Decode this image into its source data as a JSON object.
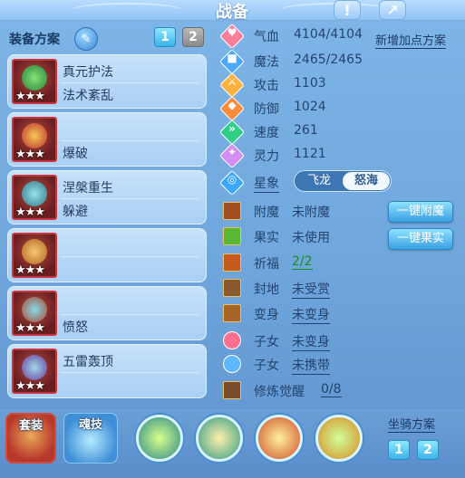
{
  "title": "战备",
  "equipment_section": {
    "label": "装备方案",
    "plan_buttons": [
      "1",
      "2"
    ],
    "active_plan": "1",
    "items": [
      {
        "line1": "真元护法",
        "line2": "法术紊乱",
        "stars": "★★★"
      },
      {
        "line1": "",
        "line2": "爆破",
        "stars": "★★★"
      },
      {
        "line1": "涅槃重生",
        "line2": "躲避",
        "stars": "★★★"
      },
      {
        "line1": "",
        "line2": "",
        "stars": "★★★"
      },
      {
        "line1": "",
        "line2": "愤怒",
        "stars": "★★★"
      },
      {
        "line1": "五雷轰顶",
        "line2": "",
        "stars": "★★★"
      }
    ]
  },
  "attributes": [
    {
      "icon": "heart-icon",
      "label": "气血",
      "value": "4104/4104",
      "color": "#ff7f9a",
      "glyph": "♥"
    },
    {
      "icon": "mana-icon",
      "label": "魔法",
      "value": "2465/2465",
      "color": "#4aa9ff",
      "glyph": "■"
    },
    {
      "icon": "attack-icon",
      "label": "攻击",
      "value": "1103",
      "color": "#ffb13b",
      "glyph": "⚔"
    },
    {
      "icon": "defense-icon",
      "label": "防御",
      "value": "1024",
      "color": "#ff8c3c",
      "glyph": "◆"
    },
    {
      "icon": "speed-icon",
      "label": "速度",
      "value": "261",
      "color": "#2fcf88",
      "glyph": "»"
    },
    {
      "icon": "spirit-icon",
      "label": "灵力",
      "value": "1121",
      "color": "#d48df2",
      "glyph": "✦"
    }
  ],
  "new_plan_link": "新增加点方案",
  "star_sign": {
    "icon": "star-sign-icon",
    "label": "星象",
    "options": [
      "飞龙",
      "怒海"
    ],
    "selected": "怒海"
  },
  "status_rows": [
    {
      "icon": "enchant-icon",
      "label": "附魔",
      "value": "未附魔",
      "style": "plain"
    },
    {
      "icon": "fruit-icon",
      "label": "果实",
      "value": "未使用",
      "style": "plain"
    },
    {
      "icon": "blessing-icon",
      "label": "祈福",
      "value": "2/2",
      "style": "green"
    },
    {
      "icon": "fief-icon",
      "label": "封地",
      "value": "未受赏",
      "style": "underline"
    },
    {
      "icon": "transform-icon",
      "label": "变身",
      "value": "未变身",
      "style": "underline"
    },
    {
      "icon": "child-icon",
      "label": "子女",
      "value": "未变身",
      "style": "underline"
    },
    {
      "icon": "paw-icon",
      "label": "子女",
      "value": "未携带",
      "style": "underline"
    },
    {
      "icon": "cultivation-icon",
      "label": "修炼觉醒",
      "value": "0/8",
      "style": "underline"
    }
  ],
  "actions": {
    "enchant": "一键附魔",
    "fruit": "一键果实"
  },
  "bottom": {
    "suit_tab": "套装",
    "soul_tab": "魂技",
    "mount_plan_label": "坐骑方案",
    "mount_buttons": [
      "1",
      "2"
    ]
  }
}
